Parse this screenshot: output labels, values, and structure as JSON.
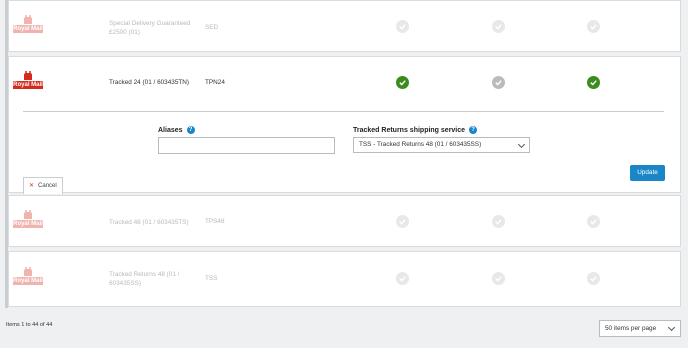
{
  "brand": {
    "logo_text": "Royal Mail",
    "red": "#d52b1e"
  },
  "rows": [
    {
      "service": "Special Delivery Guaranteed £2500 (01)",
      "code": "SED",
      "checks": [
        "faint",
        "faint",
        "faint"
      ]
    },
    {
      "service": "Tracked 24 (01 / 603435TN)",
      "code": "TPN24",
      "checks": [
        "green",
        "grey",
        "green"
      ]
    },
    {
      "service": "Tracked 48 (01 / 603435TS)",
      "code": "TPS48",
      "checks": [
        "faint",
        "faint",
        "faint"
      ]
    },
    {
      "service": "Tracked Returns 48 (01 / 603435SS)",
      "code": "TSS",
      "checks": [
        "faint",
        "faint",
        "faint"
      ]
    }
  ],
  "editor": {
    "aliases_label": "Aliases",
    "aliases_value": "",
    "returns_label": "Tracked Returns shipping service",
    "returns_value": "TSS - Tracked Returns 48 (01 / 603435SS)",
    "update_label": "Update",
    "cancel_label": "Cancel"
  },
  "footer": {
    "items_text": "Items 1 to 44 of 44",
    "page_size": "50 items per page"
  },
  "colors": {
    "accent": "#1a86c8",
    "success": "#3a8d1d"
  }
}
